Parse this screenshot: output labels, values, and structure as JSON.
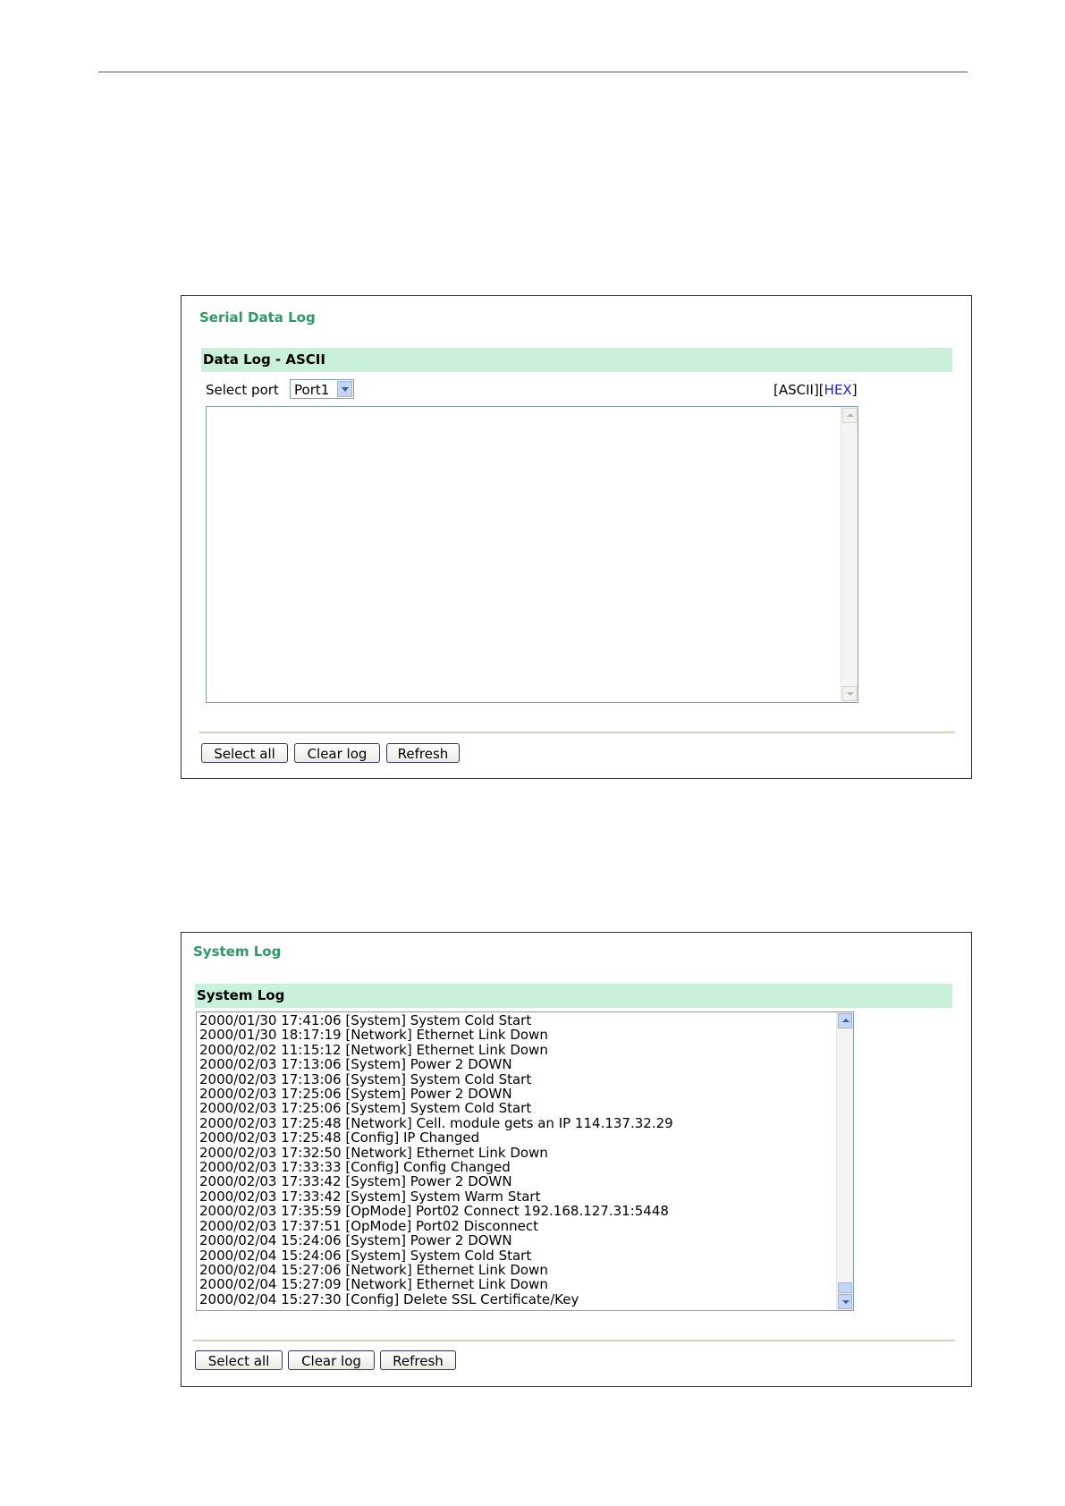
{
  "serial_panel": {
    "title": "Serial Data Log",
    "section": "Data Log - ASCII",
    "select_port_label": "Select port",
    "port_value": "Port1",
    "mode_prefix": "[ASCII][",
    "mode_hex": "HEX",
    "mode_suffix": "]",
    "buttons": {
      "select_all": "Select all",
      "clear_log": "Clear log",
      "refresh": "Refresh"
    }
  },
  "system_panel": {
    "title": "System Log",
    "section": "System Log",
    "log_lines": [
      "2000/01/30 17:41:06 [System] System Cold Start",
      "2000/01/30 18:17:19 [Network] Ethernet Link Down",
      "2000/02/02 11:15:12 [Network] Ethernet Link Down",
      "2000/02/03 17:13:06 [System] Power 2 DOWN",
      "2000/02/03 17:13:06 [System] System Cold Start",
      "2000/02/03 17:25:06 [System] Power 2 DOWN",
      "2000/02/03 17:25:06 [System] System Cold Start",
      "2000/02/03 17:25:48 [Network] Cell. module gets an IP 114.137.32.29",
      "2000/02/03 17:25:48 [Config] IP Changed",
      "2000/02/03 17:32:50 [Network] Ethernet Link Down",
      "2000/02/03 17:33:33 [Config] Config Changed",
      "2000/02/03 17:33:42 [System] Power 2 DOWN",
      "2000/02/03 17:33:42 [System] System Warm Start",
      "2000/02/03 17:35:59 [OpMode] Port02 Connect 192.168.127.31:5448",
      "2000/02/03 17:37:51 [OpMode] Port02 Disconnect",
      "2000/02/04 15:24:06 [System] Power 2 DOWN",
      "2000/02/04 15:24:06 [System] System Cold Start",
      "2000/02/04 15:27:06 [Network] Ethernet Link Down",
      "2000/02/04 15:27:09 [Network] Ethernet Link Down",
      "2000/02/04 15:27:30 [Config] Delete SSL Certificate/Key"
    ],
    "buttons": {
      "select_all": "Select all",
      "clear_log": "Clear log",
      "refresh": "Refresh"
    }
  }
}
